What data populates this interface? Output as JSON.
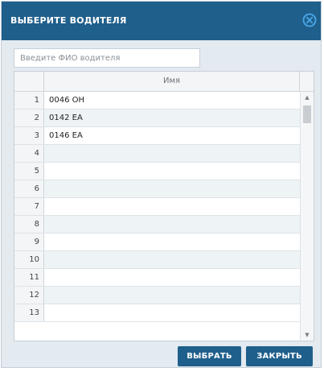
{
  "dialog": {
    "title": "ВЫБЕРИТЕ ВОДИТЕЛЯ",
    "close_icon": "circle-x-icon",
    "accent_color": "#1f5f8b"
  },
  "search": {
    "placeholder": "Введите ФИО водителя",
    "value": ""
  },
  "grid": {
    "columns": [
      "",
      "Имя"
    ],
    "rows": [
      {
        "num": "1",
        "name": "0046 OH"
      },
      {
        "num": "2",
        "name": "0142 EA"
      },
      {
        "num": "3",
        "name": "0146 EA"
      },
      {
        "num": "4",
        "name": ""
      },
      {
        "num": "5",
        "name": ""
      },
      {
        "num": "6",
        "name": ""
      },
      {
        "num": "7",
        "name": ""
      },
      {
        "num": "8",
        "name": ""
      },
      {
        "num": "9",
        "name": ""
      },
      {
        "num": "10",
        "name": ""
      },
      {
        "num": "11",
        "name": ""
      },
      {
        "num": "12",
        "name": ""
      },
      {
        "num": "13",
        "name": ""
      }
    ],
    "scroll_up_icon": "triangle-up-icon",
    "scroll_down_icon": "triangle-down-icon"
  },
  "buttons": {
    "select_label": "ВЫБРАТЬ",
    "close_label": "ЗАКРЫТЬ"
  }
}
